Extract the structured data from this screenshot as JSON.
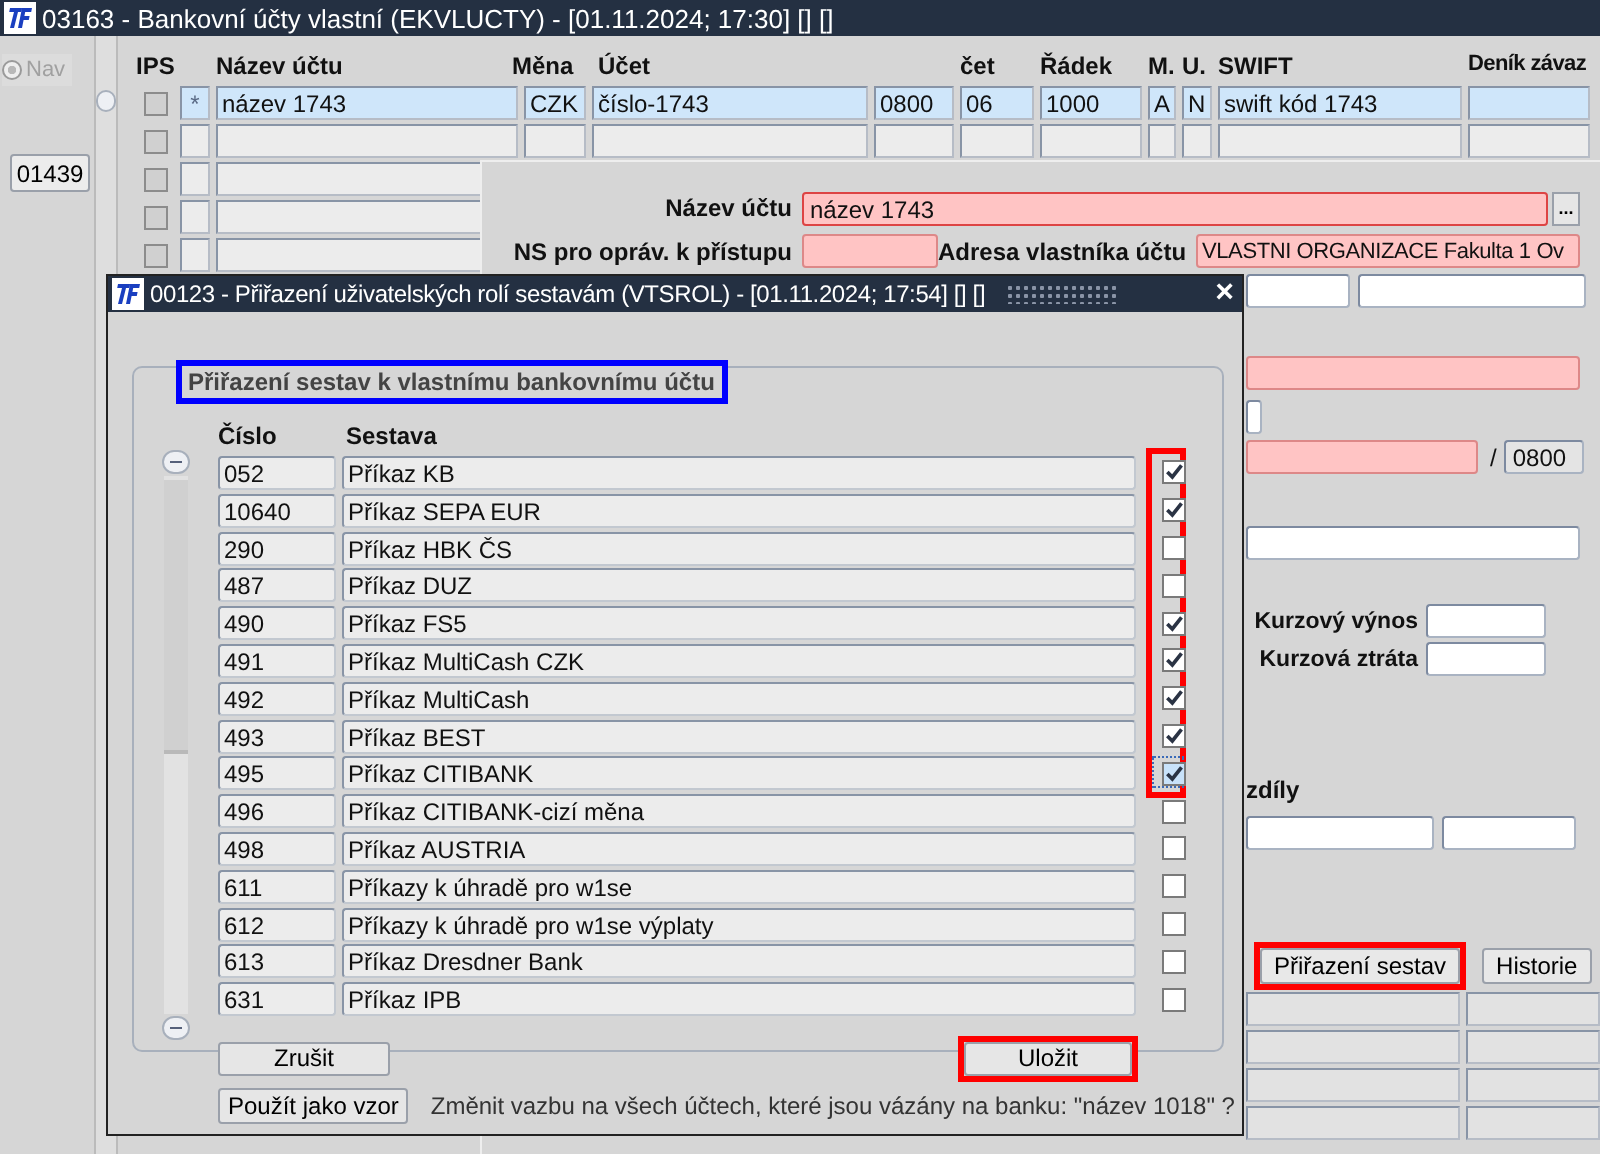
{
  "window": {
    "title": "03163 - Bankovní účty vlastní (EKVLUCTY) - [01.11.2024; 17:30] [] []"
  },
  "nav": {
    "label": "Nav",
    "disabled": true
  },
  "side_button": "01439",
  "grid": {
    "columns": [
      "IPS",
      "Název účtu",
      "Měna",
      "Účet",
      "čet",
      "Řádek",
      "M.",
      "U.",
      "SWIFT",
      "Deník závaz"
    ],
    "rows": [
      {
        "kind": "full",
        "selected": true,
        "checked": false,
        "marker": "*",
        "cells": [
          "název 1743",
          "CZK",
          "číslo-1743",
          "0800",
          "06",
          "1000",
          "A",
          "N",
          "swift kód 1743"
        ]
      },
      {
        "kind": "full",
        "selected": false,
        "checked": false
      },
      {
        "kind": "clipped",
        "selected": false,
        "checked": false
      },
      {
        "kind": "clipped",
        "selected": false,
        "checked": false
      },
      {
        "kind": "clipped",
        "selected": false,
        "checked": false
      }
    ]
  },
  "detail": {
    "rows": [
      {
        "kind": "labeled",
        "label": "Název účtu",
        "fields": [
          {
            "value": "název 1743",
            "required": true,
            "lookup": "..."
          }
        ]
      },
      {
        "kind": "labeled",
        "label": "NS pro opráv. k přístupu",
        "fields": [
          {
            "required": true
          },
          {
            "label": "Adresa vlastníka účtu",
            "value": "VLASTNI ORGANIZACE Fakulta 1 Ov",
            "required": true
          }
        ]
      },
      {
        "kind": "fields",
        "fields": [
          {
            "required": false
          },
          {
            "required": false
          }
        ]
      },
      {
        "kind": "fields",
        "fields": [
          {
            "required": true
          }
        ]
      },
      {
        "kind": "fields",
        "fields": [
          {
            "required": false
          }
        ]
      },
      {
        "kind": "fields",
        "fields": [
          {
            "required": true
          },
          {
            "prefix": "/",
            "value": "0800",
            "required": false
          }
        ]
      },
      {
        "kind": "fields",
        "fields": [
          {
            "required": false
          }
        ]
      },
      {
        "kind": "labeled-right",
        "label": "Kurzový výnos",
        "fields": [
          {
            "required": false
          }
        ]
      },
      {
        "kind": "labeled-right",
        "label": "Kurzová ztráta",
        "fields": [
          {
            "required": false
          }
        ]
      },
      {
        "kind": "caption",
        "text": "zdíly"
      },
      {
        "kind": "fields",
        "fields": [
          {
            "required": false
          },
          {
            "required": false
          }
        ]
      },
      {
        "kind": "buttons",
        "buttons": [
          {
            "label": "Přiřazení sestav",
            "highlighted": true
          },
          {
            "label": "Historie",
            "highlighted": false
          }
        ]
      },
      {
        "kind": "grid"
      },
      {
        "kind": "grid"
      },
      {
        "kind": "grid"
      },
      {
        "kind": "grid"
      }
    ]
  },
  "dialog": {
    "title": "00123 - Přiřazení uživatelských rolí sestavám (VTSROL) - [01.11.2024; 17:54] [] []",
    "close": "×",
    "group": {
      "legend": "Přiřazení sestav k vlastnímu bankovnímu účtu",
      "highlighted": true
    },
    "columns": [
      "Číslo",
      "Sestava"
    ],
    "rows": [
      {
        "number": "052",
        "name": "Příkaz KB",
        "checked": true,
        "highlighted": true,
        "focused": false
      },
      {
        "number": "10640",
        "name": "Příkaz SEPA EUR",
        "checked": true,
        "highlighted": true,
        "focused": false
      },
      {
        "number": "290",
        "name": "Příkaz HBK ČS",
        "checked": false,
        "highlighted": true,
        "focused": false
      },
      {
        "number": "487",
        "name": "Příkaz DUZ",
        "checked": false,
        "highlighted": true,
        "focused": false
      },
      {
        "number": "490",
        "name": "Příkaz FS5",
        "checked": true,
        "highlighted": true,
        "focused": false
      },
      {
        "number": "491",
        "name": "Příkaz MultiCash CZK",
        "checked": true,
        "highlighted": true,
        "focused": false
      },
      {
        "number": "492",
        "name": "Příkaz MultiCash",
        "checked": true,
        "highlighted": true,
        "focused": false
      },
      {
        "number": "493",
        "name": "Příkaz BEST",
        "checked": true,
        "highlighted": true,
        "focused": false
      },
      {
        "number": "495",
        "name": "Příkaz CITIBANK",
        "checked": true,
        "highlighted": true,
        "focused": true
      },
      {
        "number": "496",
        "name": "Příkaz CITIBANK-cizí měna",
        "checked": false,
        "highlighted": false,
        "focused": false
      },
      {
        "number": "498",
        "name": "Příkaz AUSTRIA",
        "checked": false,
        "highlighted": false,
        "focused": false
      },
      {
        "number": "611",
        "name": "Příkazy k úhradě pro w1se",
        "checked": false,
        "highlighted": false,
        "focused": false
      },
      {
        "number": "612",
        "name": "Příkazy k úhradě pro w1se výplaty",
        "checked": false,
        "highlighted": false,
        "focused": false
      },
      {
        "number": "613",
        "name": "Příkaz Dresdner Bank",
        "checked": false,
        "highlighted": false,
        "focused": false
      },
      {
        "number": "631",
        "name": "Příkaz IPB",
        "checked": false,
        "highlighted": false,
        "focused": false
      }
    ],
    "cancel": {
      "label": "Zrušit"
    },
    "save": {
      "label": "Uložit",
      "highlighted": true
    },
    "template_button": "Použít jako vzor",
    "question": "Změnit vazbu na všech účtech, které jsou vázány na banku: \"název 1018\" ?"
  }
}
